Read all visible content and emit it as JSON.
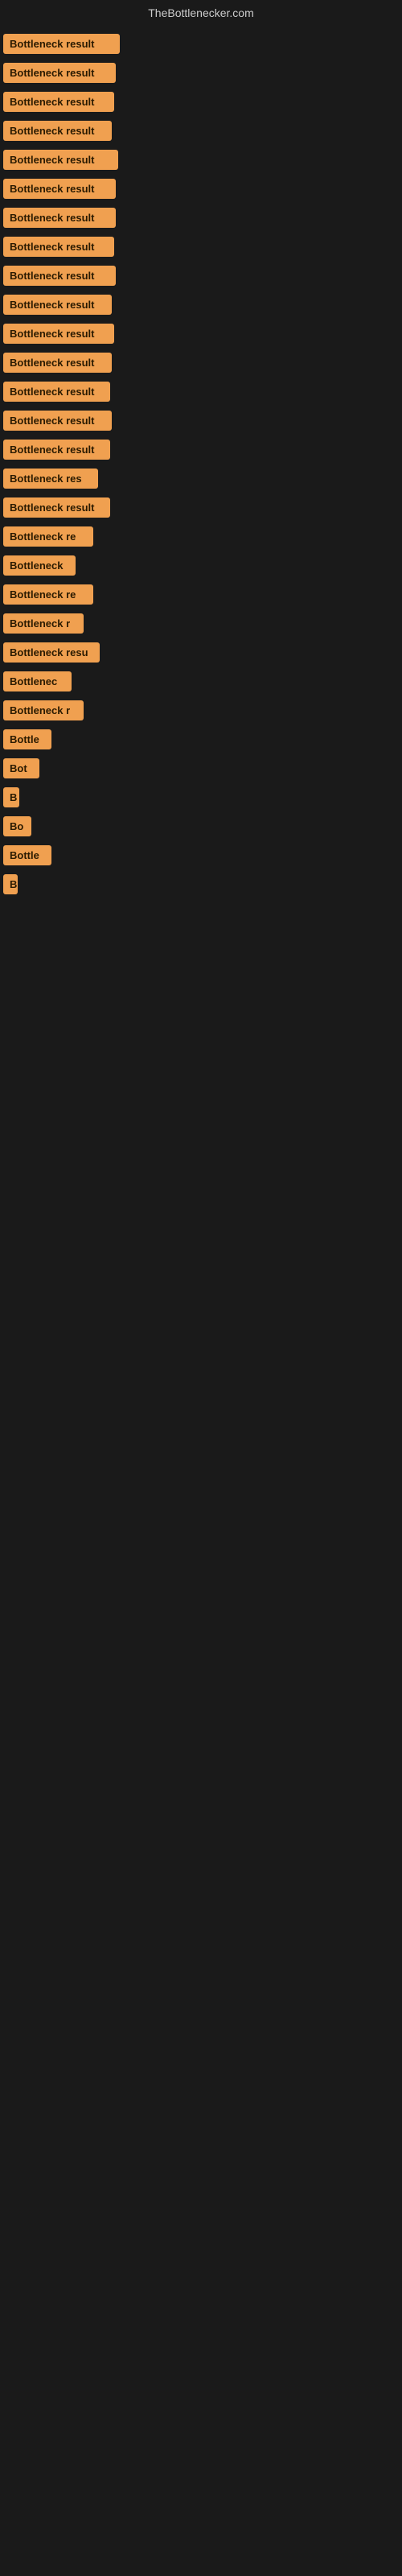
{
  "header": {
    "title": "TheBottlenecker.com"
  },
  "items": [
    {
      "label": "Bottleneck result",
      "width": 145
    },
    {
      "label": "Bottleneck result",
      "width": 140
    },
    {
      "label": "Bottleneck result",
      "width": 138
    },
    {
      "label": "Bottleneck result",
      "width": 135
    },
    {
      "label": "Bottleneck result",
      "width": 143
    },
    {
      "label": "Bottleneck result",
      "width": 140
    },
    {
      "label": "Bottleneck result",
      "width": 140
    },
    {
      "label": "Bottleneck result",
      "width": 138
    },
    {
      "label": "Bottleneck result",
      "width": 140
    },
    {
      "label": "Bottleneck result",
      "width": 135
    },
    {
      "label": "Bottleneck result",
      "width": 138
    },
    {
      "label": "Bottleneck result",
      "width": 135
    },
    {
      "label": "Bottleneck result",
      "width": 133
    },
    {
      "label": "Bottleneck result",
      "width": 135
    },
    {
      "label": "Bottleneck result",
      "width": 133
    },
    {
      "label": "Bottleneck res",
      "width": 118
    },
    {
      "label": "Bottleneck result",
      "width": 133
    },
    {
      "label": "Bottleneck re",
      "width": 112
    },
    {
      "label": "Bottleneck",
      "width": 90
    },
    {
      "label": "Bottleneck re",
      "width": 112
    },
    {
      "label": "Bottleneck r",
      "width": 100
    },
    {
      "label": "Bottleneck resu",
      "width": 120
    },
    {
      "label": "Bottlenec",
      "width": 85
    },
    {
      "label": "Bottleneck r",
      "width": 100
    },
    {
      "label": "Bottle",
      "width": 60
    },
    {
      "label": "Bot",
      "width": 45
    },
    {
      "label": "B",
      "width": 20
    },
    {
      "label": "Bo",
      "width": 35
    },
    {
      "label": "Bottle",
      "width": 60
    },
    {
      "label": "B",
      "width": 18
    }
  ]
}
